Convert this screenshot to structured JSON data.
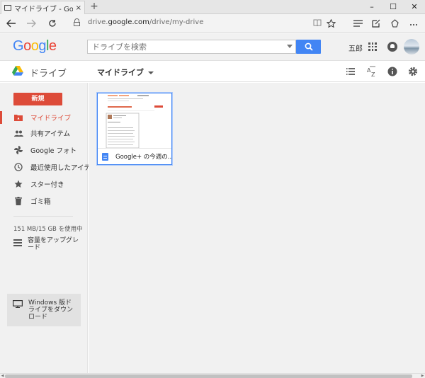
{
  "browser": {
    "tab_title": "マイドライブ - Google ドラ",
    "tab_close": "×",
    "new_tab": "+",
    "url_prefix": "drive.",
    "url_domain": "google.com",
    "url_path": "/drive/my-drive",
    "window_controls": {
      "minimize": "–",
      "maximize": "☐",
      "close": "✕"
    }
  },
  "google_header": {
    "logo_letters": [
      {
        "ch": "G",
        "color": "#4285f4"
      },
      {
        "ch": "o",
        "color": "#ea4335"
      },
      {
        "ch": "o",
        "color": "#fbbc05"
      },
      {
        "ch": "g",
        "color": "#4285f4"
      },
      {
        "ch": "l",
        "color": "#34a853"
      },
      {
        "ch": "e",
        "color": "#ea4335"
      }
    ],
    "search_placeholder": "ドライブを検索",
    "user_name": "五郎"
  },
  "drive_header": {
    "app_name": "ドライブ",
    "location": "マイドライブ"
  },
  "sidebar": {
    "new_button": "新規",
    "items": [
      {
        "label": "マイドライブ",
        "icon": "folder-drive-icon",
        "active": true
      },
      {
        "label": "共有アイテム",
        "icon": "people-icon",
        "active": false
      },
      {
        "label": "Google フォト",
        "icon": "pinwheel-icon",
        "active": false
      },
      {
        "label": "最近使用したアイテム",
        "icon": "clock-icon",
        "active": false
      },
      {
        "label": "スター付き",
        "icon": "star-icon",
        "active": false
      },
      {
        "label": "ゴミ箱",
        "icon": "trash-icon",
        "active": false
      }
    ],
    "storage": "151 MB/15 GB を使用中",
    "upgrade": "容量をアップグレード",
    "download": "Windows 版ドライブをダウンロード"
  },
  "files": [
    {
      "name": "Google+ の今週の...",
      "type": "document"
    }
  ],
  "colors": {
    "accent_red": "#dd4b39",
    "search_blue": "#4285f4"
  }
}
